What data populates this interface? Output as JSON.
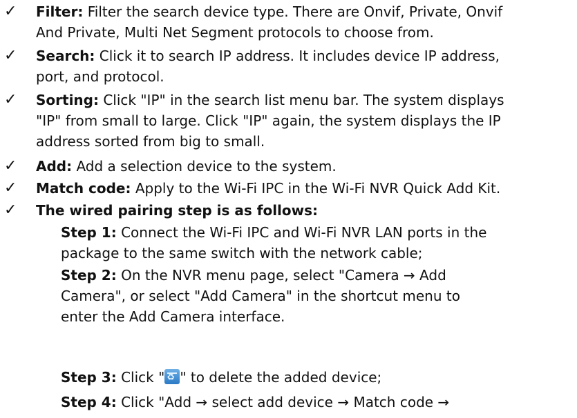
{
  "doc": {
    "check_glyph": "✓",
    "bullets": [
      {
        "label": "Filter:",
        "lines": [
          "Filter the search device type. There are Onvif, Private, Onvif",
          "And Private, Multi Net Segment protocols to choose from."
        ]
      },
      {
        "label": "Search:",
        "lines": [
          "Click it to search IP address. It includes device IP address,",
          "port, and protocol."
        ]
      },
      {
        "label": "Sorting:",
        "lines": [
          "Click \"IP\" in the search list menu bar. The system displays",
          "\"IP\" from small to large. Click \"IP\" again, the system displays the IP",
          "address sorted from big to small."
        ]
      },
      {
        "label": "Add:",
        "lines": [
          "Add a selection device to the system."
        ]
      },
      {
        "label": "Match code:",
        "lines": [
          "Apply to the Wi-Fi IPC in the Wi-Fi NVR Quick Add Kit."
        ]
      },
      {
        "label": "The wired pairing step is as follows:",
        "lines": []
      }
    ],
    "steps": [
      {
        "label": "Step 1:",
        "lines": [
          "Connect the Wi-Fi IPC and Wi-Fi NVR LAN ports in the",
          "package to the same switch with the network cable;"
        ]
      },
      {
        "label": "Step 2:",
        "lines": [
          "On the NVR menu page, select \"Camera → Add",
          "Camera\", or select \"Add Camera\" in the shortcut menu to",
          "enter the Add Camera interface."
        ]
      },
      {
        "label": "Step 3:",
        "before_icon": "Click \"",
        "icon": "recycle-bin-icon",
        "after_icon": "\" to delete the added device;"
      },
      {
        "label": "Step 4:",
        "lines": [
          "Click \"Add → select add device → Match code →"
        ]
      }
    ]
  }
}
